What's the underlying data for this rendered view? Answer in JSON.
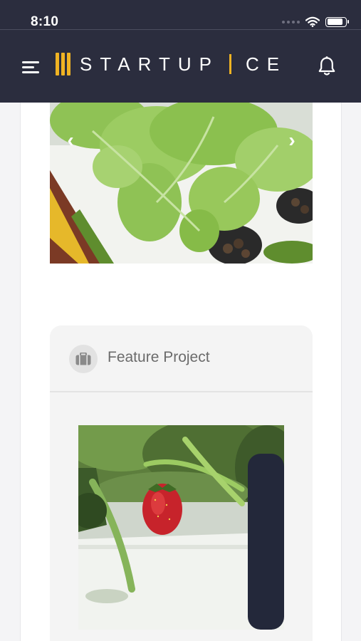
{
  "status_bar": {
    "time": "8:10",
    "icons": [
      "signal-dots-icon",
      "wifi-icon",
      "battery-icon"
    ],
    "battery_level": 0.85
  },
  "header": {
    "menu_icon": "hamburger-menu-icon",
    "logo_text_left": "STARTUP",
    "logo_text_right": "CE",
    "notification_icon": "bell-icon"
  },
  "carousel": {
    "prev_icon": "chevron-left-icon",
    "next_icon": "chevron-right-icon",
    "prev_glyph": "‹",
    "next_glyph": "›"
  },
  "feature_card": {
    "icon": "briefcase-icon",
    "title": "Feature Project"
  },
  "colors": {
    "appbar": "#2b2d3e",
    "accent": "#f0b323",
    "page_background": "#f4f4f6",
    "card_background": "#f4f4f4",
    "card_title": "#6b6b6b"
  }
}
